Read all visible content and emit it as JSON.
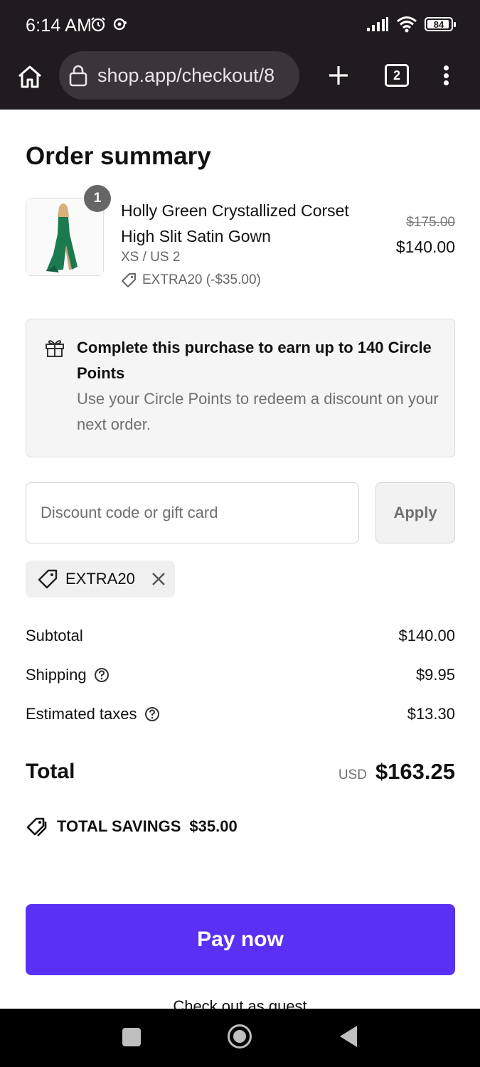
{
  "status_bar": {
    "time": "6:14 AM",
    "battery": "84",
    "icons": [
      "alarm-icon",
      "notification-icon",
      "signal-icon",
      "wifi-icon",
      "battery-icon"
    ]
  },
  "browser": {
    "url": "shop.app/checkout/8",
    "tab_count": "2",
    "icons": [
      "home-icon",
      "lock-icon",
      "plus-icon",
      "tabs-icon",
      "more-vertical-icon"
    ]
  },
  "order": {
    "title": "Order summary",
    "item": {
      "quantity": "1",
      "name": "Holly Green Crystallized Corset High Slit Satin Gown",
      "variant": "XS / US 2",
      "discount": "EXTRA20 (-$35.00)",
      "original_price": "$175.00",
      "price": "$140.00"
    },
    "points": {
      "title": "Complete this purchase to earn up to 140 Circle Points",
      "description": "Use your Circle Points to redeem a discount on your next order."
    },
    "discount_field": {
      "placeholder": "Discount code or gift card",
      "value": "",
      "apply_label": "Apply"
    },
    "applied_code": "EXTRA20",
    "summary": {
      "subtotal_label": "Subtotal",
      "subtotal_value": "$140.00",
      "shipping_label": "Shipping",
      "shipping_value": "$9.95",
      "taxes_label": "Estimated taxes",
      "taxes_value": "$13.30",
      "total_label": "Total",
      "currency": "USD",
      "total_value": "$163.25",
      "savings_label": "TOTAL SAVINGS",
      "savings_value": "$35.00"
    },
    "pay_label": "Pay now",
    "guest_label": "Check out as guest"
  },
  "colors": {
    "accent": "#5a31f4",
    "chrome": "#1f1b1e",
    "url_pill": "#3b3438",
    "dress_green": "#1c7a50"
  }
}
